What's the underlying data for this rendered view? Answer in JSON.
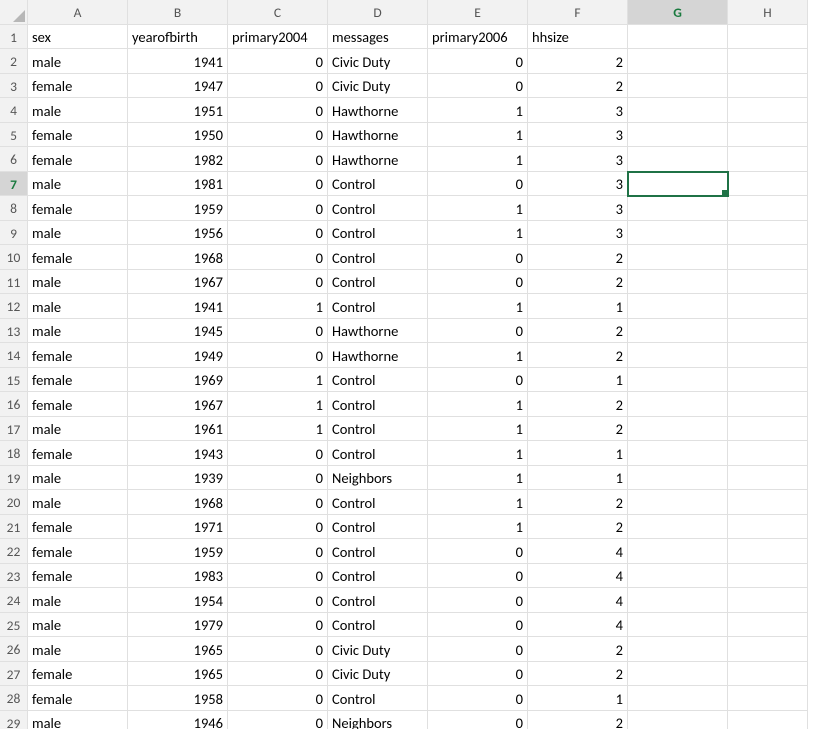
{
  "columns": [
    "A",
    "B",
    "C",
    "D",
    "E",
    "F",
    "G",
    "H"
  ],
  "headers": [
    "sex",
    "yearofbirth",
    "primary2004",
    "messages",
    "primary2006",
    "hhsize"
  ],
  "numeric_cols": [
    1,
    2,
    4,
    5
  ],
  "rows": [
    [
      "male",
      1941,
      0,
      "Civic Duty",
      0,
      2
    ],
    [
      "female",
      1947,
      0,
      "Civic Duty",
      0,
      2
    ],
    [
      "male",
      1951,
      0,
      "Hawthorne",
      1,
      3
    ],
    [
      "female",
      1950,
      0,
      "Hawthorne",
      1,
      3
    ],
    [
      "female",
      1982,
      0,
      "Hawthorne",
      1,
      3
    ],
    [
      "male",
      1981,
      0,
      "Control",
      0,
      3
    ],
    [
      "female",
      1959,
      0,
      "Control",
      1,
      3
    ],
    [
      "male",
      1956,
      0,
      "Control",
      1,
      3
    ],
    [
      "female",
      1968,
      0,
      "Control",
      0,
      2
    ],
    [
      "male",
      1967,
      0,
      "Control",
      0,
      2
    ],
    [
      "male",
      1941,
      1,
      "Control",
      1,
      1
    ],
    [
      "male",
      1945,
      0,
      "Hawthorne",
      0,
      2
    ],
    [
      "female",
      1949,
      0,
      "Hawthorne",
      1,
      2
    ],
    [
      "female",
      1969,
      1,
      "Control",
      0,
      1
    ],
    [
      "female",
      1967,
      1,
      "Control",
      1,
      2
    ],
    [
      "male",
      1961,
      1,
      "Control",
      1,
      2
    ],
    [
      "female",
      1943,
      0,
      "Control",
      1,
      1
    ],
    [
      "male",
      1939,
      0,
      "Neighbors",
      1,
      1
    ],
    [
      "male",
      1968,
      0,
      "Control",
      1,
      2
    ],
    [
      "female",
      1971,
      0,
      "Control",
      1,
      2
    ],
    [
      "female",
      1959,
      0,
      "Control",
      0,
      4
    ],
    [
      "female",
      1983,
      0,
      "Control",
      0,
      4
    ],
    [
      "male",
      1954,
      0,
      "Control",
      0,
      4
    ],
    [
      "male",
      1979,
      0,
      "Control",
      0,
      4
    ],
    [
      "male",
      1965,
      0,
      "Civic Duty",
      0,
      2
    ],
    [
      "female",
      1965,
      0,
      "Civic Duty",
      0,
      2
    ],
    [
      "female",
      1958,
      0,
      "Control",
      0,
      1
    ],
    [
      "male",
      1946,
      0,
      "Neighbors",
      0,
      2
    ]
  ],
  "active": {
    "row": 7,
    "col": "G"
  }
}
